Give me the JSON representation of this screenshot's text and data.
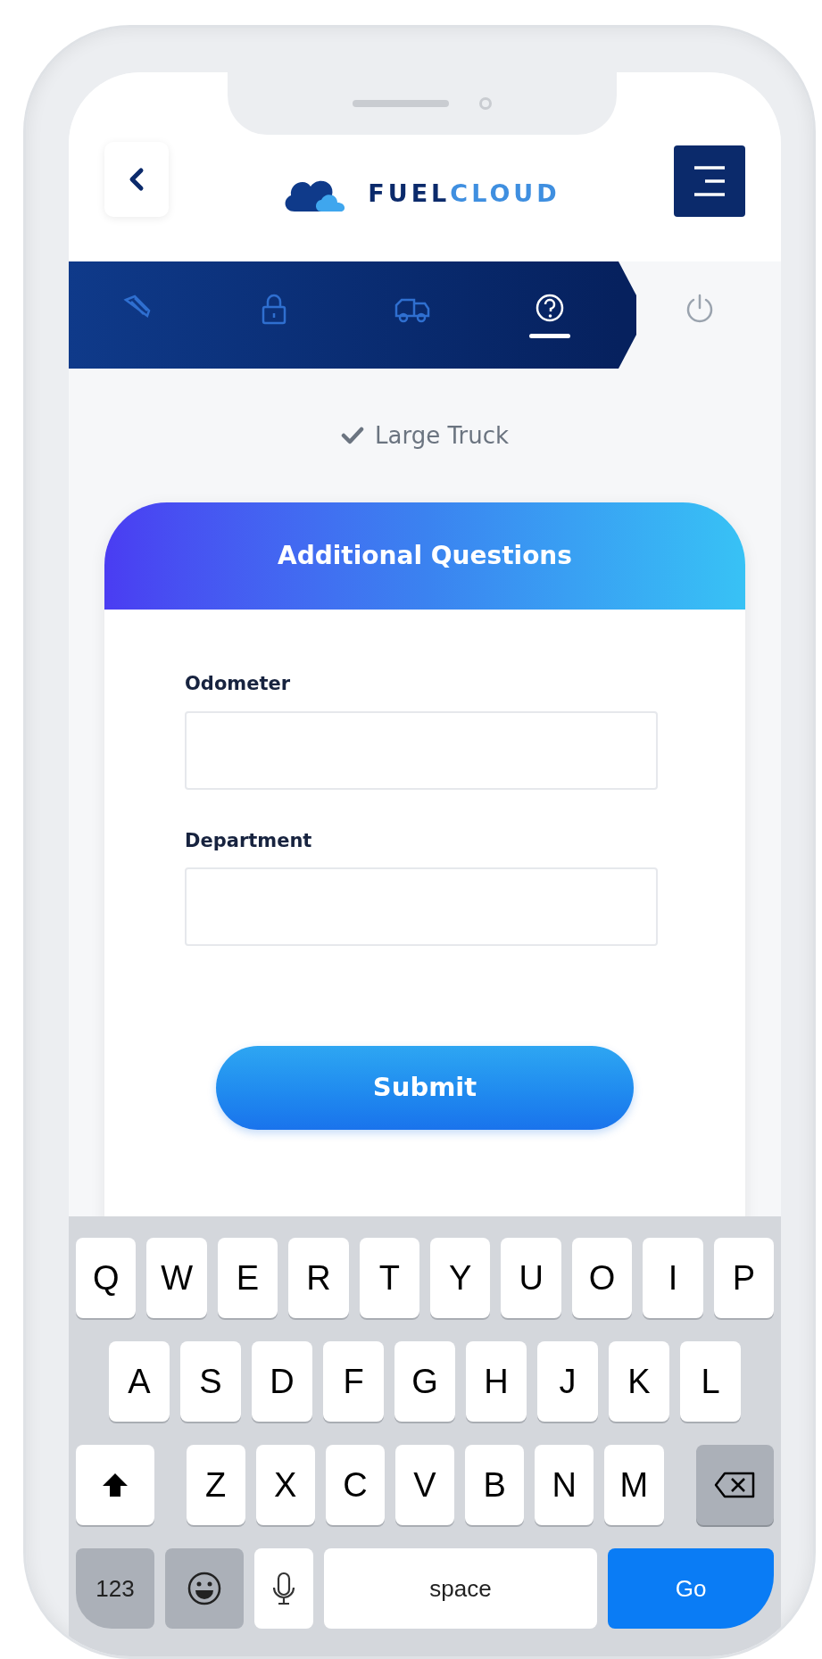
{
  "header": {
    "logo": {
      "part_1": "FUEL",
      "part_2": "CLOUD"
    }
  },
  "steps": [
    {
      "selected": false
    },
    {
      "selected": false
    },
    {
      "selected": false
    },
    {
      "selected": true
    },
    {
      "selected": false
    }
  ],
  "vehicle": {
    "label": "Large Truck",
    "checked": true
  },
  "card": {
    "title": "Additional Questions",
    "fields": [
      {
        "label": "Odometer"
      },
      {
        "label": "Department"
      }
    ],
    "submit": "Submit"
  },
  "keyboard": {
    "rows": [
      [
        {
          "kind": "letter",
          "label": "Q"
        },
        {
          "kind": "letter",
          "label": "W"
        },
        {
          "kind": "letter",
          "label": "E"
        },
        {
          "kind": "letter",
          "label": "R"
        },
        {
          "kind": "letter",
          "label": "T"
        },
        {
          "kind": "letter",
          "label": "Y"
        },
        {
          "kind": "letter",
          "label": "U"
        },
        {
          "kind": "letter",
          "label": "O"
        },
        {
          "kind": "letter",
          "label": "I"
        },
        {
          "kind": "letter",
          "label": "P"
        }
      ],
      [
        {
          "kind": "letter",
          "label": "A"
        },
        {
          "kind": "letter",
          "label": "S"
        },
        {
          "kind": "letter",
          "label": "D"
        },
        {
          "kind": "letter",
          "label": "F"
        },
        {
          "kind": "letter",
          "label": "G"
        },
        {
          "kind": "letter",
          "label": "H"
        },
        {
          "kind": "letter",
          "label": "J"
        },
        {
          "kind": "letter",
          "label": "K"
        },
        {
          "kind": "letter",
          "label": "L"
        }
      ],
      [
        {
          "kind": "shift"
        },
        {
          "kind": "letter",
          "label": "Z"
        },
        {
          "kind": "letter",
          "label": "X"
        },
        {
          "kind": "letter",
          "label": "C"
        },
        {
          "kind": "letter",
          "label": "V"
        },
        {
          "kind": "letter",
          "label": "B"
        },
        {
          "kind": "letter",
          "label": "N"
        },
        {
          "kind": "letter",
          "label": "M"
        },
        {
          "kind": "backspace"
        }
      ],
      [
        {
          "kind": "numbers",
          "label": "123"
        },
        {
          "kind": "emoji"
        },
        {
          "kind": "mic"
        },
        {
          "kind": "space",
          "label": "space"
        },
        {
          "kind": "go",
          "label": "Go"
        }
      ]
    ]
  }
}
